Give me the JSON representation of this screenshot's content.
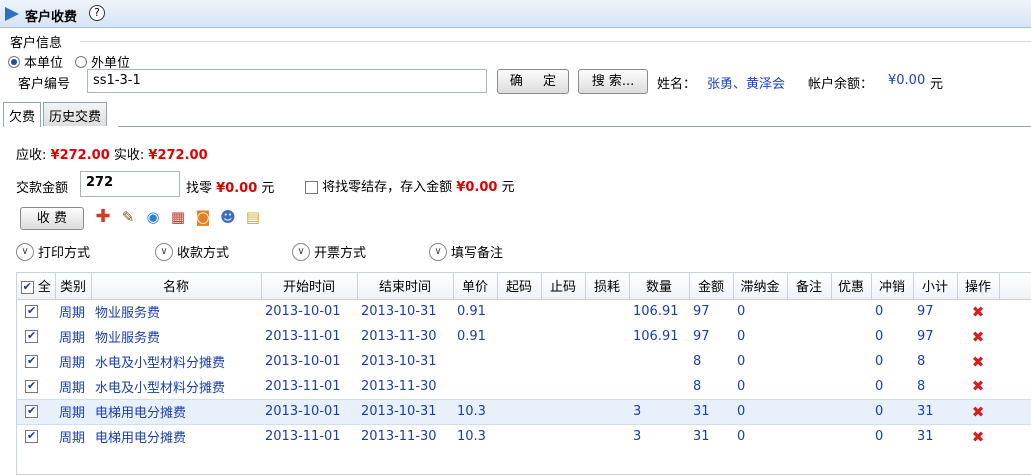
{
  "page": {
    "title": "客户收费",
    "help": "?"
  },
  "customer_info": {
    "group_label": "客户信息",
    "radio_own": "本单位",
    "radio_external": "外单位",
    "code_label": "客户编号",
    "code_value": "ss1-3-1",
    "confirm_label": "确 定",
    "search_label": "搜 索...",
    "name_label": "姓名：",
    "name_value": "张勇、黄泽会",
    "balance_label": "帐户余额：",
    "balance_value": "¥0.00",
    "balance_unit": "元"
  },
  "tabs": [
    {
      "label": "欠费"
    },
    {
      "label": "历史交费"
    }
  ],
  "summary": {
    "receivable_label": "应收:",
    "receivable_value": "¥272.00",
    "received_label": "实收:",
    "received_value": "¥272.00",
    "payment_label": "交款金额",
    "payment_value": "272",
    "change_label": "找零",
    "change_value": "¥0.00",
    "change_unit": "元",
    "save_change_label": "将找零结存，存入金额",
    "save_change_value": "¥0.00",
    "save_change_unit": "元"
  },
  "toolbar": {
    "collect_label": "收 费",
    "icons": [
      "add-icon",
      "edit-icon",
      "refresh-icon",
      "calendar-icon",
      "rss-icon",
      "user-icon",
      "note-icon"
    ]
  },
  "expanders": [
    {
      "label": "打印方式"
    },
    {
      "label": "收款方式"
    },
    {
      "label": "开票方式"
    },
    {
      "label": "填写备注"
    }
  ],
  "table": {
    "select_all_label": "全",
    "columns": [
      "类别",
      "名称",
      "开始时间",
      "结束时间",
      "单价",
      "起码",
      "止码",
      "损耗",
      "数量",
      "金额",
      "滞纳金",
      "备注",
      "优惠",
      "冲销",
      "小计",
      "操作"
    ],
    "rows": [
      {
        "category": "周期",
        "name": "物业服务费",
        "start": "2013-10-01",
        "end": "2013-10-31",
        "price": "0.91",
        "start_read": "",
        "end_read": "",
        "loss": "",
        "qty": "106.91",
        "amount": "97",
        "late_fee": "0",
        "remark": "",
        "discount": "",
        "offset": "0",
        "subtotal": "97"
      },
      {
        "category": "周期",
        "name": "物业服务费",
        "start": "2013-11-01",
        "end": "2013-11-30",
        "price": "0.91",
        "start_read": "",
        "end_read": "",
        "loss": "",
        "qty": "106.91",
        "amount": "97",
        "late_fee": "0",
        "remark": "",
        "discount": "",
        "offset": "0",
        "subtotal": "97"
      },
      {
        "category": "周期",
        "name": "水电及小型材料分摊费",
        "start": "2013-10-01",
        "end": "2013-10-31",
        "price": "",
        "start_read": "",
        "end_read": "",
        "loss": "",
        "qty": "",
        "amount": "8",
        "late_fee": "0",
        "remark": "",
        "discount": "",
        "offset": "0",
        "subtotal": "8"
      },
      {
        "category": "周期",
        "name": "水电及小型材料分摊费",
        "start": "2013-11-01",
        "end": "2013-11-30",
        "price": "",
        "start_read": "",
        "end_read": "",
        "loss": "",
        "qty": "",
        "amount": "8",
        "late_fee": "0",
        "remark": "",
        "discount": "",
        "offset": "0",
        "subtotal": "8"
      },
      {
        "category": "周期",
        "name": "电梯用电分摊费",
        "start": "2013-10-01",
        "end": "2013-10-31",
        "price": "10.3",
        "start_read": "",
        "end_read": "",
        "loss": "",
        "qty": "3",
        "amount": "31",
        "late_fee": "0",
        "remark": "",
        "discount": "",
        "offset": "0",
        "subtotal": "31"
      },
      {
        "category": "周期",
        "name": "电梯用电分摊费",
        "start": "2013-11-01",
        "end": "2013-11-30",
        "price": "10.3",
        "start_read": "",
        "end_read": "",
        "loss": "",
        "qty": "3",
        "amount": "31",
        "late_fee": "0",
        "remark": "",
        "discount": "",
        "offset": "0",
        "subtotal": "31"
      }
    ]
  }
}
